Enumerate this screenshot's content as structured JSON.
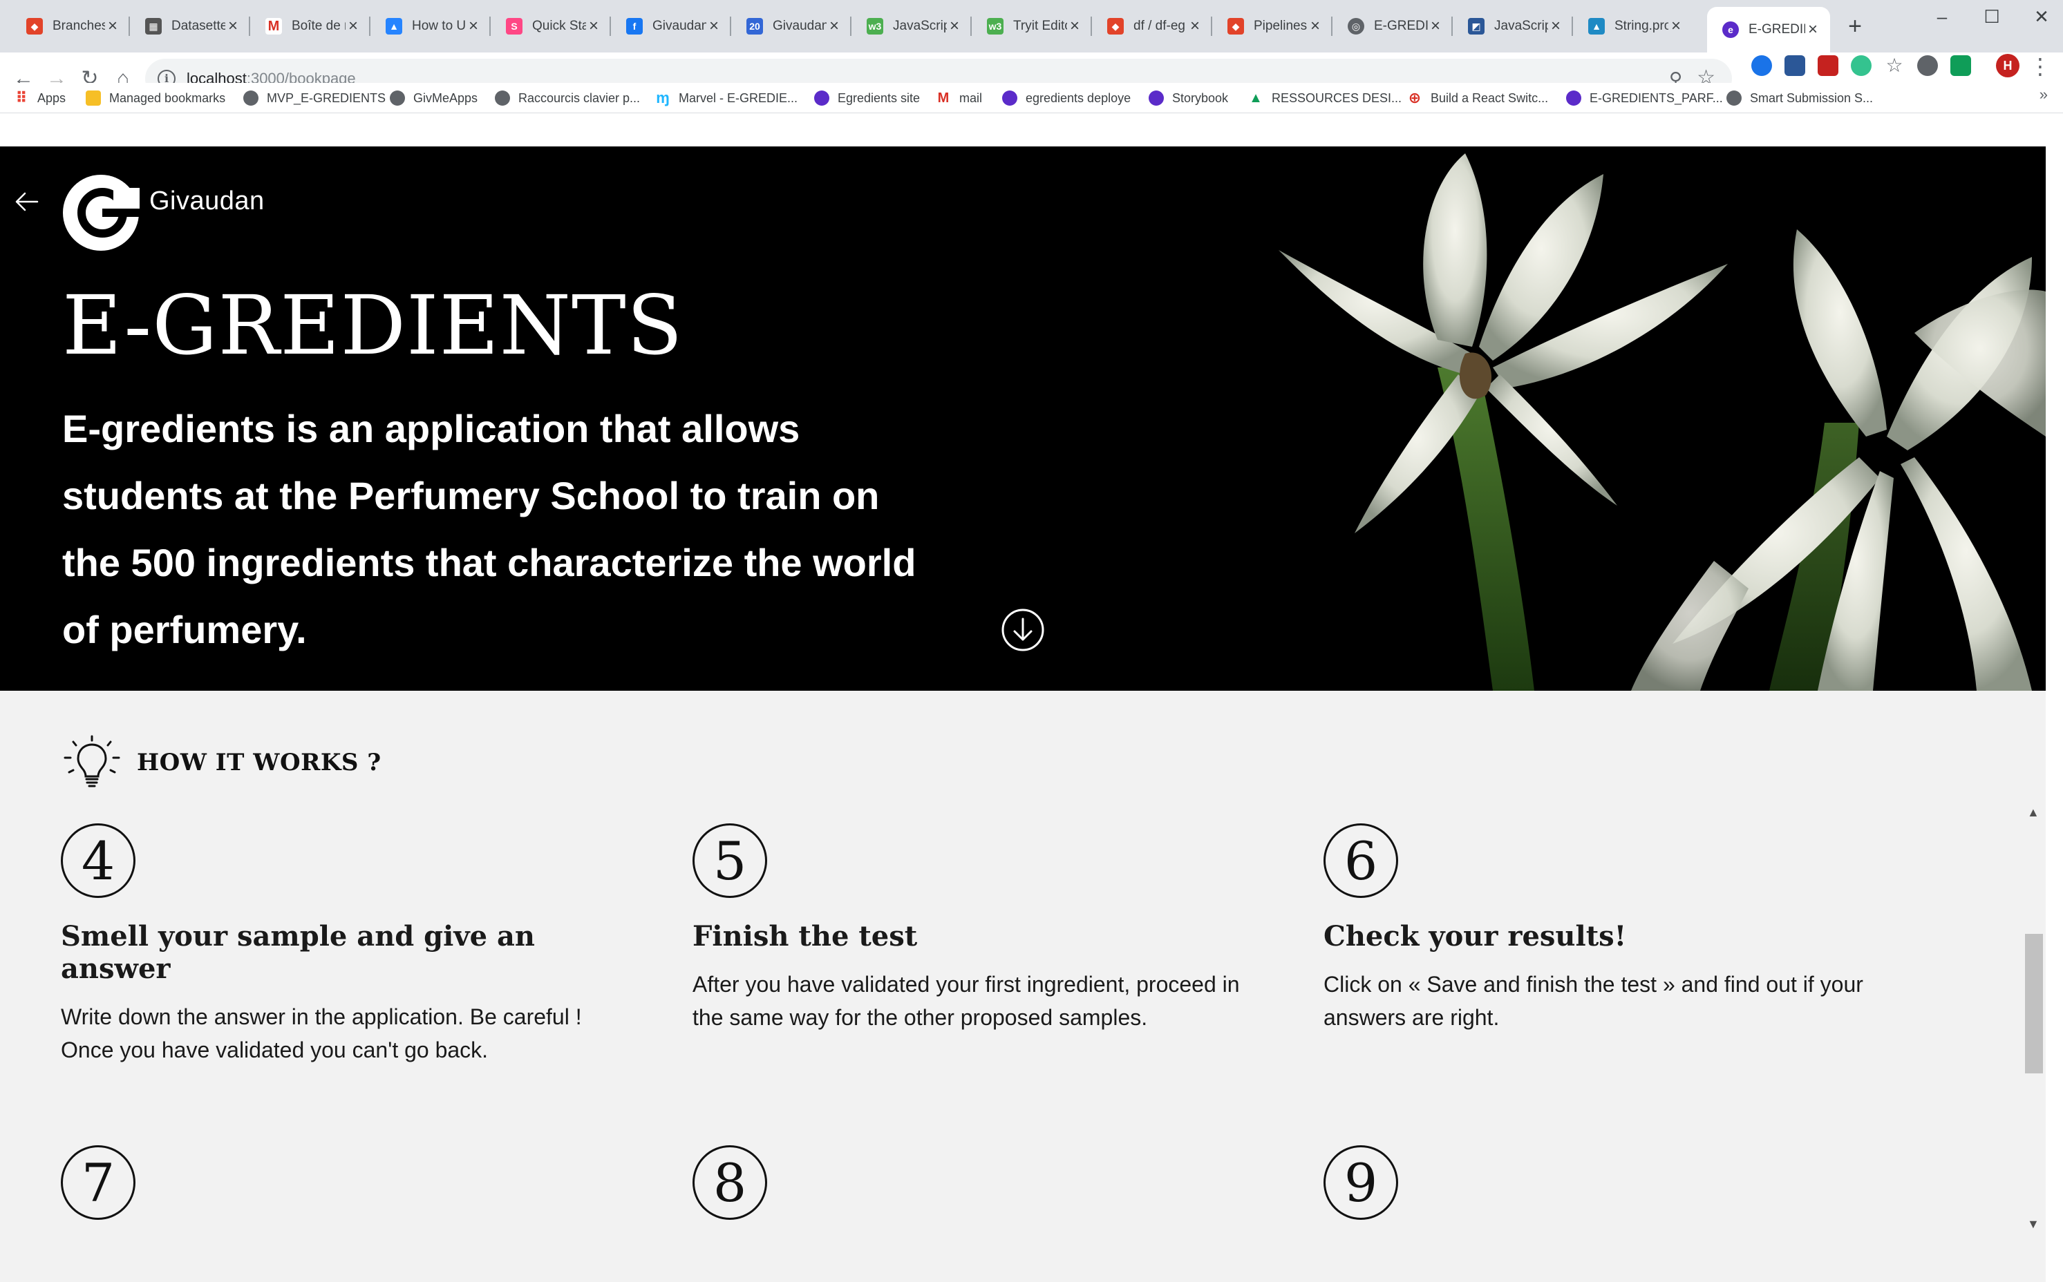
{
  "browser": {
    "tabs": [
      {
        "title": "Branches",
        "icon": "gitlab-icon",
        "color": "#e24329"
      },
      {
        "title": "Datasette",
        "icon": "datasette-icon",
        "color": "#555555"
      },
      {
        "title": "Boîte de r",
        "icon": "gmail-icon",
        "color": "#d93025"
      },
      {
        "title": "How to U",
        "icon": "atlassian-icon",
        "color": "#2684ff"
      },
      {
        "title": "Quick Sta",
        "icon": "storybook-icon",
        "color": "#ff4785"
      },
      {
        "title": "Givaudan",
        "icon": "facebook-icon",
        "color": "#1877f2"
      },
      {
        "title": "Givaudan",
        "icon": "calendar-icon",
        "color": "#3367d6"
      },
      {
        "title": "JavaScript",
        "icon": "w3schools-icon",
        "color": "#4caf50"
      },
      {
        "title": "Tryit Edito",
        "icon": "w3schools-icon",
        "color": "#4caf50"
      },
      {
        "title": "df / df-eg",
        "icon": "gitlab-icon",
        "color": "#e24329"
      },
      {
        "title": "Pipelines",
        "icon": "gitlab-icon",
        "color": "#e24329"
      },
      {
        "title": "E-GREDIE",
        "icon": "globe-icon",
        "color": "#5f6368"
      },
      {
        "title": "JavaScript",
        "icon": "mdn-icon",
        "color": "#2b5797"
      },
      {
        "title": "String.pro",
        "icon": "mdn-dino-icon",
        "color": "#1f8ac4"
      },
      {
        "title": "E-GREDIE",
        "icon": "egredients-icon",
        "color": "#5b2bc9",
        "active": true
      }
    ],
    "new_tab_label": "+",
    "window_controls": {
      "minimize": "–",
      "maximize": "☐",
      "close": "✕"
    },
    "url_host": "localhost",
    "url_rest": ":3000/bookpage",
    "bookmarks": [
      {
        "label": "Apps",
        "icon": "apps-grid-icon",
        "color": "#4285f4"
      },
      {
        "label": "Managed bookmarks",
        "icon": "folder-icon",
        "color": "#f6bf26"
      },
      {
        "label": "MVP_E-GREDIENTS",
        "icon": "globe-icon",
        "color": "#5f6368"
      },
      {
        "label": "GivMeApps",
        "icon": "globe-icon",
        "color": "#5f6368"
      },
      {
        "label": "Raccourcis clavier p...",
        "icon": "globe-icon",
        "color": "#5f6368"
      },
      {
        "label": "Marvel - E-GREDIE...",
        "icon": "marvel-icon",
        "color": "#1fb6ff"
      },
      {
        "label": "Egredients site",
        "icon": "egredients-icon",
        "color": "#5b2bc9"
      },
      {
        "label": "mail",
        "icon": "gmail-icon",
        "color": "#d93025"
      },
      {
        "label": "egredients deploye",
        "icon": "egredients-icon",
        "color": "#5b2bc9"
      },
      {
        "label": "Storybook",
        "icon": "egredients-icon",
        "color": "#5b2bc9"
      },
      {
        "label": "RESSOURCES DESI...",
        "icon": "drive-icon",
        "color": "#0f9d58"
      },
      {
        "label": "Build a React Switc...",
        "icon": "lifebuoy-icon",
        "color": "#d93025"
      },
      {
        "label": "E-GREDIENTS_PARF...",
        "icon": "egredients-icon",
        "color": "#5b2bc9"
      },
      {
        "label": "Smart Submission S...",
        "icon": "globe-icon",
        "color": "#5f6368"
      }
    ],
    "bookmarks_more": "»",
    "profile_initial": "H"
  },
  "hero": {
    "brand": "Givaudan",
    "title": "E-GREDIENTS",
    "description": "E-gredients is an application that allows students at the Perfumery School to train on the 500 ingredients that characterize the world of perfumery."
  },
  "how_it_works": {
    "title": "HOW IT WORKS ?",
    "steps": [
      {
        "number": "4",
        "title": "Smell your sample and give an answer",
        "description": "Write down the answer in the application. Be careful ! Once you have validated you can't go back."
      },
      {
        "number": "5",
        "title": "Finish the test",
        "description": "After you have validated your first ingredient, proceed in the same way for the other proposed samples."
      },
      {
        "number": "6",
        "title": "Check your results!",
        "description": "Click on « Save and finish the test » and find out if your answers are right."
      },
      {
        "number": "7",
        "title": "",
        "description": ""
      },
      {
        "number": "8",
        "title": "",
        "description": ""
      },
      {
        "number": "9",
        "title": "",
        "description": ""
      }
    ]
  },
  "colors": {
    "hero_background": "#000000",
    "content_background": "#f2f2f2",
    "text": "#1a1a1a",
    "brand_purple": "#5b2bc9"
  }
}
